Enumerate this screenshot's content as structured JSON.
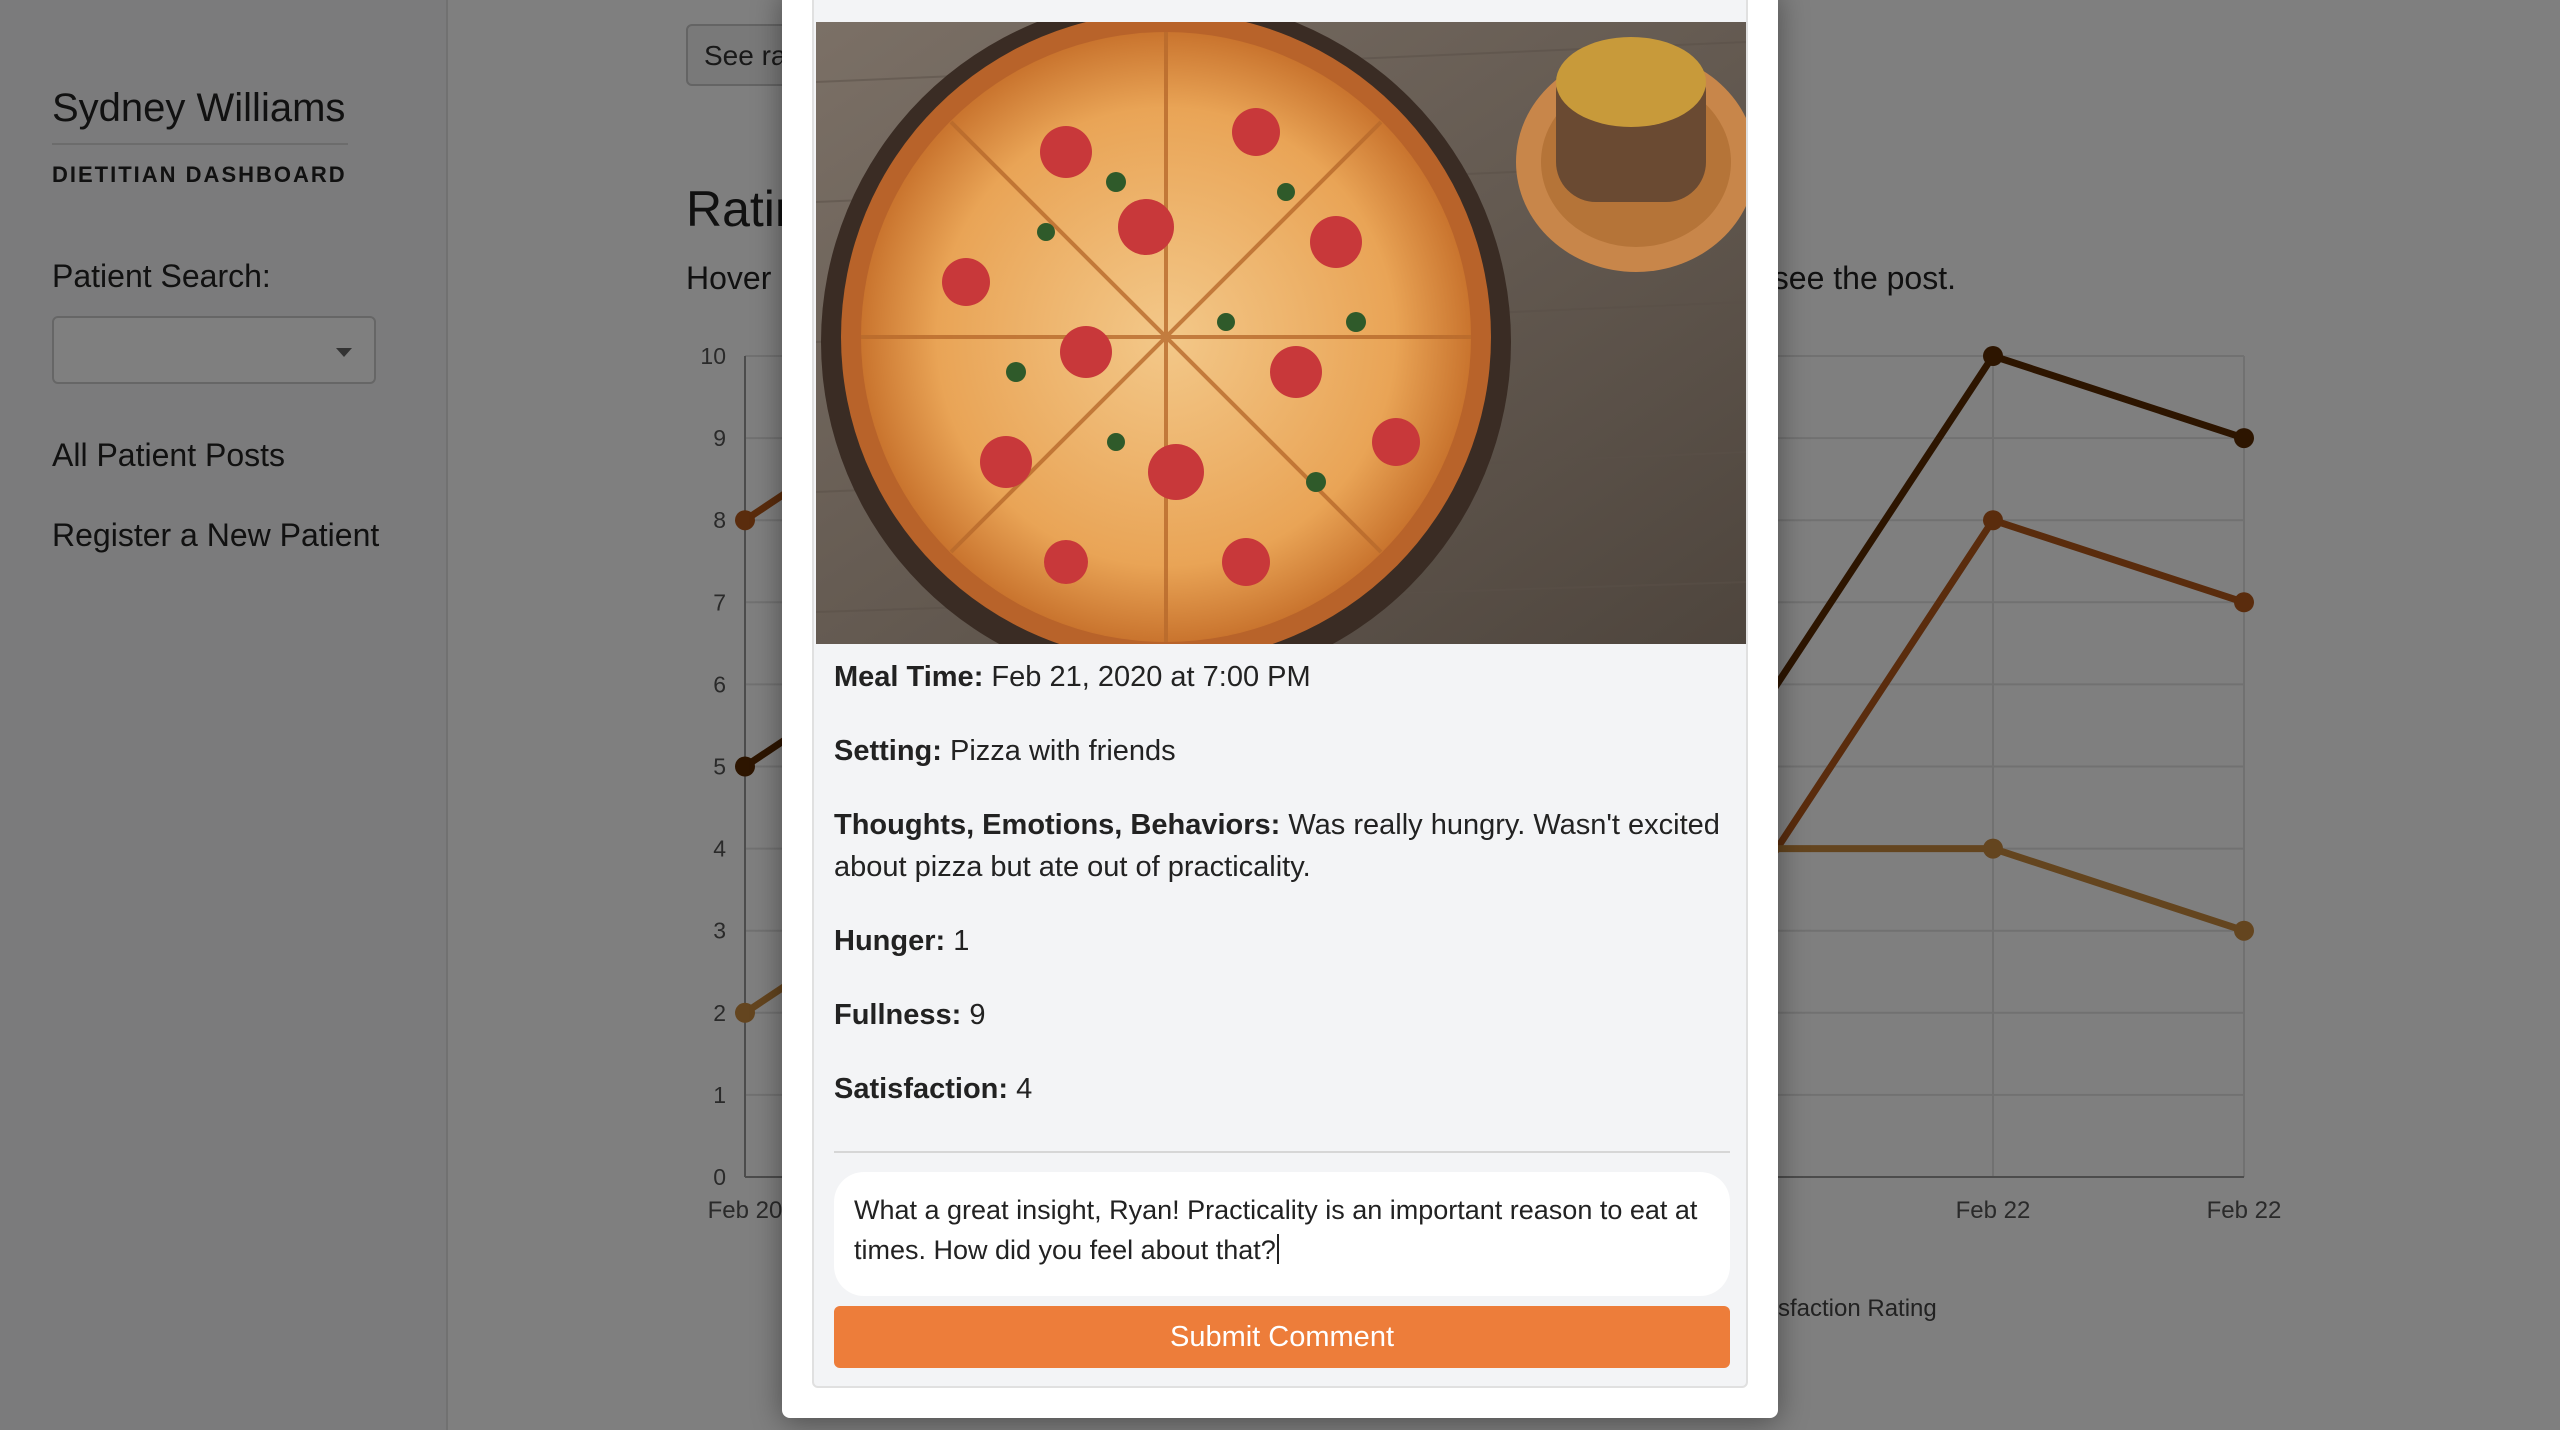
{
  "sidebar": {
    "user_name": "Sydney Williams",
    "dashboard_label": "DIETITIAN DASHBOARD",
    "search_label": "Patient Search:",
    "search_value": "",
    "nav": [
      "All Patient Posts",
      "Register a New Patient"
    ]
  },
  "main": {
    "see_button_partial": "See ra",
    "title_partial": "Ratin",
    "subtitle_left": "Hover",
    "subtitle_right": "see the post.",
    "legend_partial": "sfaction Rating"
  },
  "chart_data": {
    "type": "line",
    "y_ticks": [
      "0",
      "1",
      "2",
      "3",
      "4",
      "5",
      "6",
      "7",
      "8",
      "9",
      "10"
    ],
    "ylim": [
      0,
      10
    ],
    "x_ticks_visible": [
      "Feb 20",
      "Feb 22",
      "Feb 22"
    ],
    "grid": true,
    "series": [
      {
        "color": "#5a2a00",
        "values_visible": [
          {
            "x": "Feb 20",
            "y": 5
          },
          {
            "x": "Feb 22",
            "y": 10
          },
          {
            "x": "Feb 22",
            "y": 9
          }
        ]
      },
      {
        "color": "#b4581a",
        "values_visible": [
          {
            "x": "Feb 20",
            "y": 8
          },
          {
            "x": "Feb 22",
            "y": 8
          },
          {
            "x": "Feb 22",
            "y": 7
          }
        ]
      },
      {
        "color": "#c98a3e",
        "values_visible": [
          {
            "x": "Feb 20",
            "y": 2
          },
          {
            "x": "Feb 22",
            "y": 4
          },
          {
            "x": "Feb 22",
            "y": 3
          }
        ]
      }
    ]
  },
  "modal": {
    "meal_time_label": "Meal Time:",
    "meal_time": "Feb 21, 2020 at 7:00 PM",
    "setting_label": "Setting:",
    "setting": "Pizza with friends",
    "thoughts_label": "Thoughts, Emotions, Behaviors:",
    "thoughts": "Was really hungry. Wasn't excited about pizza but ate out of practicality.",
    "hunger_label": "Hunger:",
    "hunger": "1",
    "fullness_label": "Fullness:",
    "fullness": "9",
    "satisfaction_label": "Satisfaction:",
    "satisfaction": "4",
    "comment_text": "What a great insight, Ryan! Practicality is an important reason to eat at times. How did you feel about that?",
    "submit_label": "Submit Comment"
  },
  "colors": {
    "accent": "#ed7d3a",
    "series_dark": "#5a2a00",
    "series_mid": "#b4581a",
    "series_light": "#c98a3e"
  }
}
